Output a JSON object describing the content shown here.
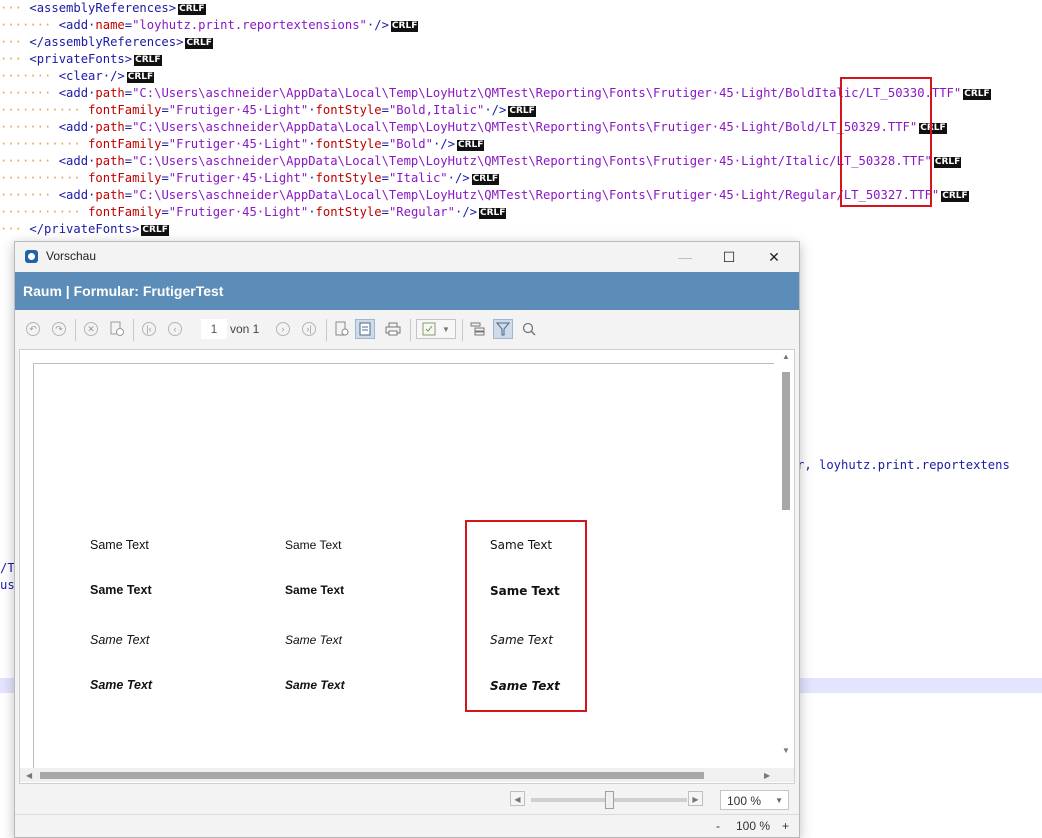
{
  "editor": {
    "lines": [
      {
        "indent": 1,
        "parts": [
          [
            "tag",
            "<assemblyReferences>"
          ]
        ]
      },
      {
        "indent": 2,
        "parts": [
          [
            "tag",
            "<add "
          ],
          [
            "attr",
            "name"
          ],
          [
            "tag",
            "="
          ],
          [
            "val",
            "\"loyhutz.print.reportextensions\""
          ],
          [
            "tag",
            " />"
          ]
        ]
      },
      {
        "indent": 1,
        "parts": [
          [
            "tag",
            "</assemblyReferences>"
          ]
        ]
      },
      {
        "indent": 1,
        "parts": [
          [
            "tag",
            "<privateFonts>"
          ]
        ]
      },
      {
        "indent": 2,
        "parts": [
          [
            "tag",
            "<clear />"
          ]
        ]
      },
      {
        "indent": 2,
        "parts": [
          [
            "tag",
            "<add "
          ],
          [
            "attr",
            "path"
          ],
          [
            "tag",
            "="
          ],
          [
            "val",
            "\"C:\\Users\\aschneider\\AppData\\Local\\Temp\\LoyHutz\\QMTest\\Reporting\\Fonts\\Frutiger 45 Light/BoldItalic/LT_50330.TTF\""
          ]
        ]
      },
      {
        "indent": 3,
        "parts": [
          [
            "attr",
            "fontFamily"
          ],
          [
            "tag",
            "="
          ],
          [
            "val",
            "\"Frutiger 45 Light\""
          ],
          [
            "tag",
            " "
          ],
          [
            "attr",
            "fontStyle"
          ],
          [
            "tag",
            "="
          ],
          [
            "val",
            "\"Bold,Italic\""
          ],
          [
            "tag",
            " />"
          ]
        ]
      },
      {
        "indent": 2,
        "parts": [
          [
            "tag",
            "<add "
          ],
          [
            "attr",
            "path"
          ],
          [
            "tag",
            "="
          ],
          [
            "val",
            "\"C:\\Users\\aschneider\\AppData\\Local\\Temp\\LoyHutz\\QMTest\\Reporting\\Fonts\\Frutiger 45 Light/Bold/LT_50329.TTF\""
          ]
        ]
      },
      {
        "indent": 3,
        "parts": [
          [
            "attr",
            "fontFamily"
          ],
          [
            "tag",
            "="
          ],
          [
            "val",
            "\"Frutiger 45 Light\""
          ],
          [
            "tag",
            " "
          ],
          [
            "attr",
            "fontStyle"
          ],
          [
            "tag",
            "="
          ],
          [
            "val",
            "\"Bold\""
          ],
          [
            "tag",
            " />"
          ]
        ]
      },
      {
        "indent": 2,
        "parts": [
          [
            "tag",
            "<add "
          ],
          [
            "attr",
            "path"
          ],
          [
            "tag",
            "="
          ],
          [
            "val",
            "\"C:\\Users\\aschneider\\AppData\\Local\\Temp\\LoyHutz\\QMTest\\Reporting\\Fonts\\Frutiger 45 Light/Italic/LT_50328.TTF\""
          ]
        ]
      },
      {
        "indent": 3,
        "parts": [
          [
            "attr",
            "fontFamily"
          ],
          [
            "tag",
            "="
          ],
          [
            "val",
            "\"Frutiger 45 Light\""
          ],
          [
            "tag",
            " "
          ],
          [
            "attr",
            "fontStyle"
          ],
          [
            "tag",
            "="
          ],
          [
            "val",
            "\"Italic\""
          ],
          [
            "tag",
            " />"
          ]
        ]
      },
      {
        "indent": 2,
        "parts": [
          [
            "tag",
            "<add "
          ],
          [
            "attr",
            "path"
          ],
          [
            "tag",
            "="
          ],
          [
            "val",
            "\"C:\\Users\\aschneider\\AppData\\Local\\Temp\\LoyHutz\\QMTest\\Reporting\\Fonts\\Frutiger 45 Light/Regular/LT_50327.TTF\""
          ]
        ]
      },
      {
        "indent": 3,
        "parts": [
          [
            "attr",
            "fontFamily"
          ],
          [
            "tag",
            "="
          ],
          [
            "val",
            "\"Frutiger 45 Light\""
          ],
          [
            "tag",
            " "
          ],
          [
            "attr",
            "fontStyle"
          ],
          [
            "tag",
            "="
          ],
          [
            "val",
            "\"Regular\""
          ],
          [
            "tag",
            " />"
          ]
        ]
      },
      {
        "indent": 1,
        "parts": [
          [
            "tag",
            "</privateFonts>"
          ]
        ]
      }
    ],
    "eol_marker": "CRLF",
    "fragments": {
      "right_text": "r, loyhutz.print.reportextens",
      "left_a": "/T",
      "left_b": "us"
    },
    "highlight_color": "#d4151d"
  },
  "window": {
    "title": "Vorschau",
    "minimize": "—",
    "maximize": "☐",
    "close": "✕",
    "banner_title": "Raum | Formular: FrutigerTest",
    "banner_color": "#5b8db8",
    "toolbar": {
      "page_current": "1",
      "page_of": "von 1"
    },
    "samples": {
      "text": "Same Text",
      "columns": [
        [
          "Same Text",
          "Same Text",
          "Same Text",
          "Same Text"
        ],
        [
          "Same Text",
          "Same Text",
          "Same Text",
          "Same Text"
        ],
        [
          "Same Text",
          "Same Text",
          "Same Text",
          "Same Text"
        ]
      ]
    },
    "zoom": {
      "select_value": "100 %",
      "status_minus": "-",
      "status_value": "100 %",
      "status_plus": "+"
    }
  }
}
